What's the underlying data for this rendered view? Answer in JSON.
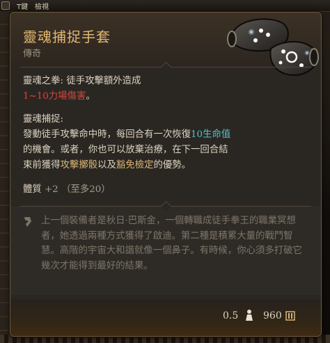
{
  "hud": {
    "key_label": "T鍵",
    "view_label": "檢視"
  },
  "item": {
    "name": "靈魂捕捉手套",
    "rarity": "傳奇",
    "passive1": {
      "title": "靈魂之拳:",
      "desc": "徒手攻擊額外造成",
      "damage": "1~10力場傷害",
      "suffix": "。"
    },
    "passive2": {
      "title": "靈魂捕捉:",
      "line1_a": "發動徒手攻擊命中時，每回合有一次恢復",
      "line1_b": "10生命值",
      "line2": "的機會。或者，你也可以放棄治療，在下一回合結",
      "line3_a": "束前獲得",
      "line3_b": "攻擊擲骰",
      "line3_c": "以及",
      "line3_d": "豁免檢定",
      "line3_e": "的優勢。"
    },
    "stat": {
      "name": "體質",
      "value": "+2",
      "cap": "（至多20）"
    },
    "lore": "上一個裝備者是秋日·巴斯金，一個轉職成徒手拳王的職業冥想者，她透過兩種方式獲得了啟迪。第二種是積累大量的戰鬥智慧。高階的宇宙大和諧就像一個鼻子。有時候，你心須多打破它幾次才能得到最好的結果。",
    "weight": "0.5",
    "price": "960"
  },
  "colors": {
    "name": "#e2b772",
    "damage": "#d9433a",
    "heal": "#52c3c7",
    "keyword": "#d9b472"
  },
  "icons": [
    "gauntlets-art",
    "lore-quill-icon",
    "weight-icon",
    "gold-coin-icon"
  ]
}
